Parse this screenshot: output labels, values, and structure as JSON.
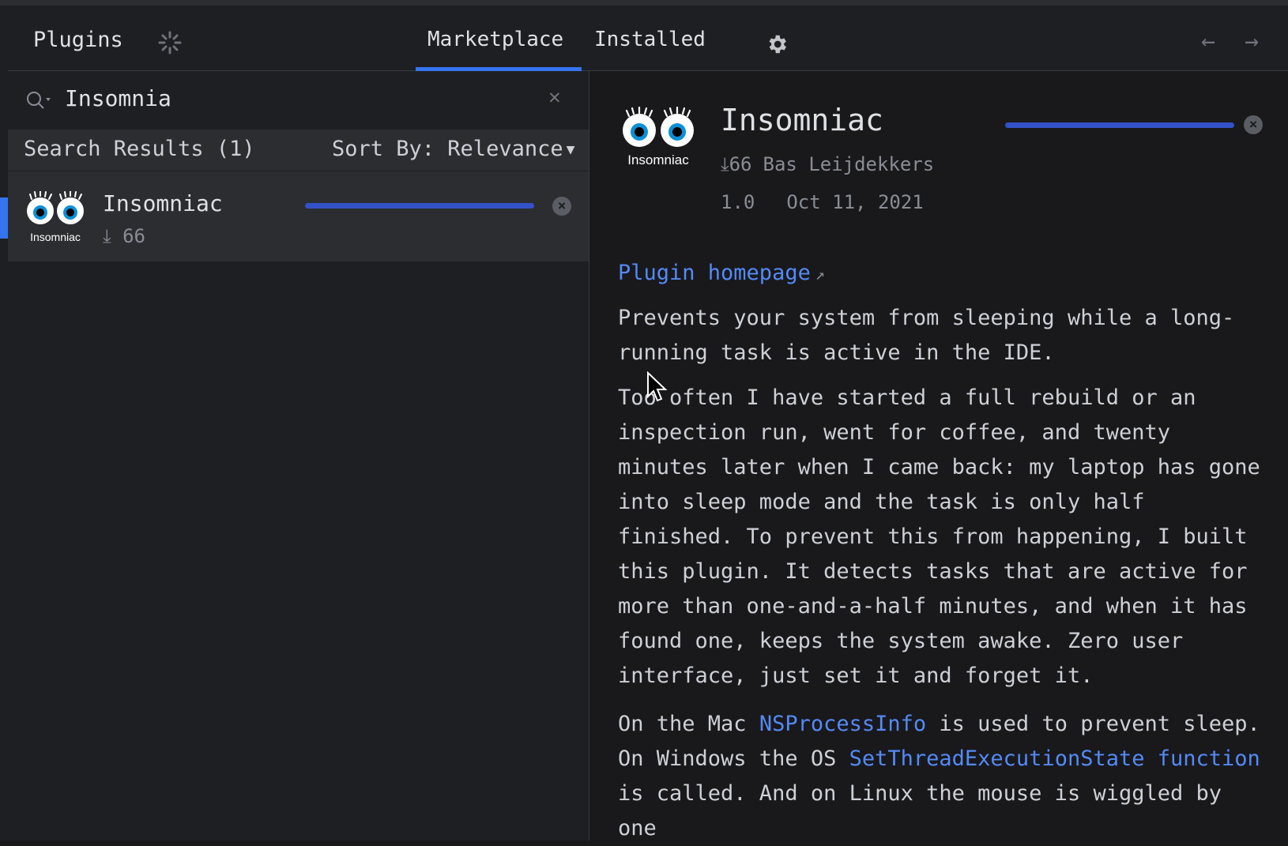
{
  "header": {
    "title": "Plugins",
    "tabs": {
      "marketplace": "Marketplace",
      "installed": "Installed"
    },
    "nav": {
      "back": "←",
      "forward": "→"
    }
  },
  "search": {
    "value": "Insomnia",
    "clear": "✕"
  },
  "results": {
    "label": "Search Results (1)",
    "sort": "Sort By: Relevance",
    "items": [
      {
        "name": "Insomniac",
        "downloads": "66",
        "logo_text": "Insomniac",
        "progress": 1.0
      }
    ]
  },
  "detail": {
    "name": "Insomniac",
    "logo_text": "Insomniac",
    "downloads": "66",
    "vendor": "Bas Leijdekkers",
    "version": "1.0",
    "date": "Oct 11, 2021",
    "homepage": "Plugin homepage",
    "homepage_arrow": "↗",
    "progress": 1.0,
    "p1": "Prevents your system from sleeping while a long-running task is active in the IDE.",
    "p2": "Too often I have started a full rebuild or an inspection run, went for coffee, and twenty minutes later when I came back: my laptop has gone into sleep mode and the task is only half finished. To prevent this from happening, I built this plugin. It detects tasks that are active for more than one-and-a-half minutes, and when it has found one, keeps the system awake. Zero user interface, just set it and forget it.",
    "p3_a": "On the Mac ",
    "p3_link1": "NSProcessInfo",
    "p3_b": " is used to prevent sleep. On Windows the OS ",
    "p3_link2": "SetThreadExecutionState function",
    "p3_c": " is called. And on Linux the mouse is wiggled by one"
  },
  "colors": {
    "accent": "#3574f0",
    "link": "#548af7",
    "progress": "#3352c7",
    "logo_iris": "#0a8fd6"
  },
  "icons": {
    "spinner": "spinner-icon",
    "gear": "gear-icon",
    "search": "search-icon",
    "download": "download-icon",
    "cancel": "cancel-icon",
    "cursor": "mouse-cursor-icon"
  }
}
